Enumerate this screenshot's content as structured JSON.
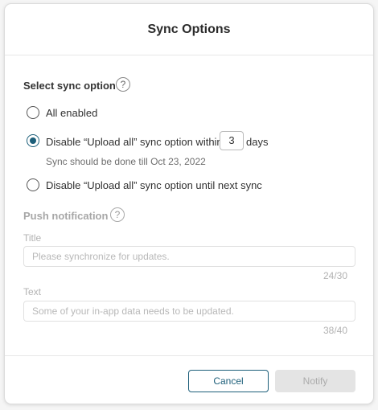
{
  "dialog": {
    "title": "Sync Options",
    "select_label": "Select sync option",
    "help_glyph": "?",
    "options": [
      {
        "label": "All enabled",
        "selected": false
      },
      {
        "label_before": "Disable “Upload all” sync option within",
        "value": "3",
        "label_after": "days",
        "selected": true,
        "hint": "Sync should be done till Oct 23, 2022"
      },
      {
        "label": "Disable “Upload all” sync option until next sync",
        "selected": false
      }
    ],
    "push": {
      "label": "Push notification",
      "title_label": "Title",
      "title_placeholder": "Please synchronize for updates.",
      "title_counter": "24/30",
      "text_label": "Text",
      "text_placeholder": "Some of your in-app data needs to be updated.",
      "text_counter": "38/40"
    },
    "buttons": {
      "cancel": "Cancel",
      "notify": "Notify"
    }
  },
  "colors": {
    "accent": "#1d5f7a",
    "disabled_button": "#e4e4e4"
  }
}
